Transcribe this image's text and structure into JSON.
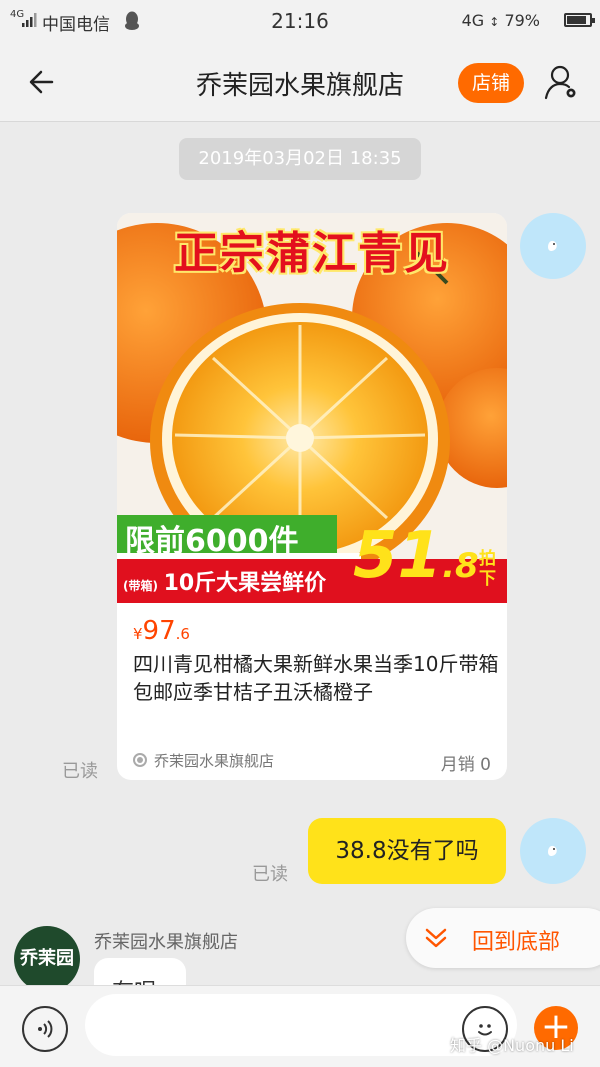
{
  "status_bar": {
    "network_type": "4G",
    "carrier": "中国电信",
    "time": "21:16",
    "right_network": "4G",
    "battery": "79%",
    "battery_level": 0.79,
    "notification_icon": "qq-penguin-icon"
  },
  "nav": {
    "back_icon": "arrow-left-icon",
    "title": "乔茉园水果旗舰店",
    "shop_label": "店铺",
    "user_icon": "user-settings-icon",
    "accent_color": "#ff6a00"
  },
  "chat": {
    "timestamp": "2019年03月02日 18:35",
    "product_card": {
      "image": {
        "headline": "正宗蒲江青见",
        "limit_badge": "限前6000件",
        "box_tag": "(带箱)",
        "promo_text": "10斤大果尝鲜价",
        "promo_price_main": "51",
        "promo_price_decimal": ".8",
        "buy_tag": "拍下"
      },
      "price_symbol": "¥",
      "price_integer": "97",
      "price_decimal": ".6",
      "description": "四川青见柑橘大果新鲜水果当季10斤带箱包邮应季甘桔子丑沃橘橙子",
      "shop_name": "乔茉园水果旗舰店",
      "monthly_sales": "月销 0"
    },
    "read_label_1": "已读",
    "my_message": "38.8没有了吗",
    "read_label_2": "已读",
    "shop_sender_name": "乔茉园水果旗舰店",
    "shop_avatar_text": "乔茉园",
    "shop_reply_partial": "有呢",
    "back_to_bottom": "回到底部"
  },
  "input_bar": {
    "placeholder": "",
    "voice_icon": "voice-wave-icon",
    "emoji_icon": "smiley-icon",
    "plus_icon": "plus-icon"
  },
  "watermark": "知乎 @Nuonu Li"
}
